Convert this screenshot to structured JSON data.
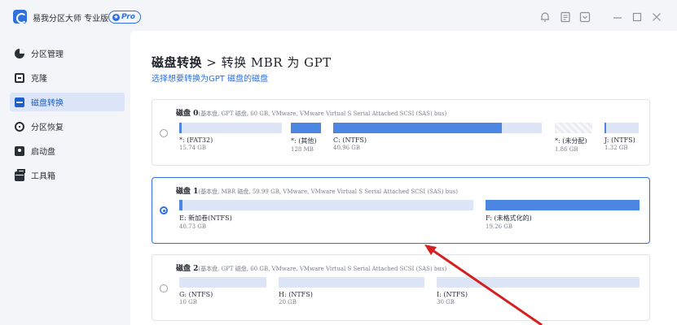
{
  "titlebar": {
    "app_name": "易我分区大师 专业版",
    "badge": "Pro",
    "icons": [
      "bell-icon",
      "notes-icon",
      "menu-icon",
      "minimize-icon",
      "maximize-icon",
      "close-icon"
    ]
  },
  "sidebar": {
    "items": [
      {
        "label": "分区管理",
        "icon": "pie-chart-icon",
        "active": false
      },
      {
        "label": "克隆",
        "icon": "clone-icon",
        "active": false
      },
      {
        "label": "磁盘转换",
        "icon": "disk-convert-icon",
        "active": true
      },
      {
        "label": "分区恢复",
        "icon": "recover-icon",
        "active": false
      },
      {
        "label": "启动盘",
        "icon": "boot-disk-icon",
        "active": false
      },
      {
        "label": "工具箱",
        "icon": "toolbox-icon",
        "active": false
      }
    ]
  },
  "main": {
    "title_bold": "磁盘转换",
    "title_rest": " > 转换 MBR 为 GPT",
    "subtitle": "选择想要转换为GPT 磁盘的磁盘"
  },
  "disks": [
    {
      "name": "磁盘 0",
      "info": "(基本盘, GPT 磁盘, 60 GB, VMware,  VMware Virtual S Serial Attached SCSI (SAS) bus)",
      "selected": false,
      "partitions": [
        {
          "label": "*: (FAT32)",
          "size": "15.74 GB",
          "used_fraction": 0.02
        },
        {
          "label": "*: (其他)",
          "size": "128 MB",
          "used_fraction": 1.0
        },
        {
          "label": "C: (NTFS)",
          "size": "40.96 GB",
          "used_fraction": 0.81
        },
        {
          "label": "*: (未分配)",
          "size": "1.86 GB",
          "used_fraction": 0,
          "unallocated": true
        },
        {
          "label": "J: (NTFS)",
          "size": "1.32 GB",
          "used_fraction": 0.04
        }
      ]
    },
    {
      "name": "磁盘 1",
      "info": "(基本盘, MBR 磁盘, 59.99 GB, VMware,  VMware Virtual S Serial Attached SCSI (SAS) bus)",
      "selected": true,
      "partitions": [
        {
          "label": "E: 新加卷(NTFS)",
          "size": "40.73 GB",
          "used_fraction": 0.01
        },
        {
          "label": "F: (未格式化的)",
          "size": "19.26 GB",
          "used_fraction": 1.0
        }
      ]
    },
    {
      "name": "磁盘 2",
      "info": "(基本盘, GPT 磁盘, 60 GB, VMware,  VMware Virtual S Serial Attached SCSI (SAS) bus)",
      "selected": false,
      "partitions": [
        {
          "label": "G: (NTFS)",
          "size": "10 GB",
          "used_fraction": 0
        },
        {
          "label": "H: (NTFS)",
          "size": "20 GB",
          "used_fraction": 0
        },
        {
          "label": "I: (NTFS)",
          "size": "30 GB",
          "used_fraction": 0
        }
      ]
    }
  ],
  "colors": {
    "accent": "#2f6fde",
    "used_fill": "#4a86e2",
    "annotation_arrow": "#d42020"
  }
}
